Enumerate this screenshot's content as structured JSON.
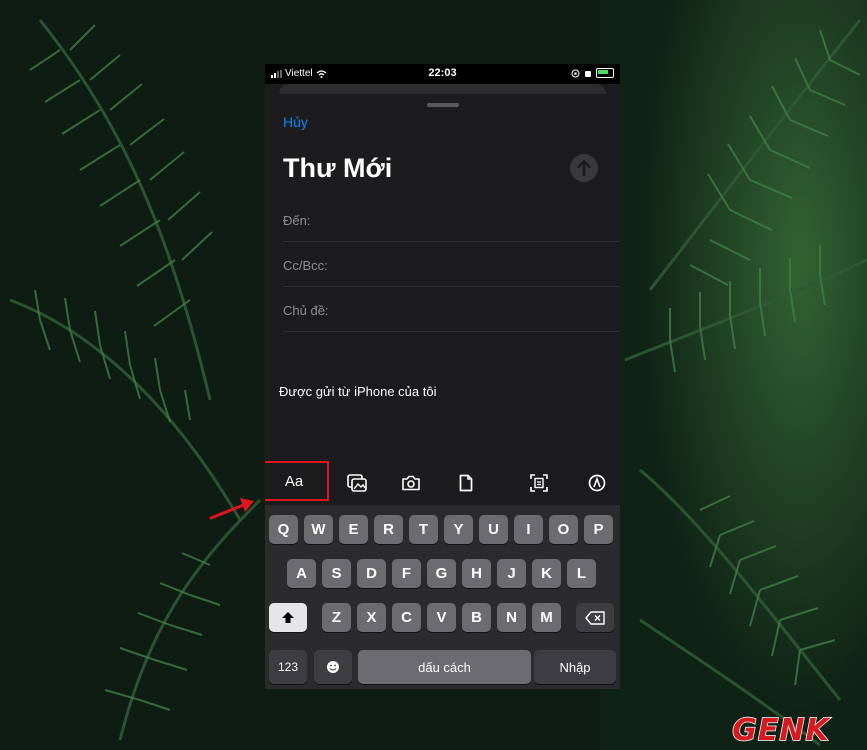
{
  "status_bar": {
    "carrier": "Viettel",
    "time": "22:03"
  },
  "compose": {
    "cancel_label": "Hủy",
    "title": "Thư Mới",
    "fields": [
      {
        "label": "Đến:"
      },
      {
        "label": "Cc/Bcc:"
      },
      {
        "label": "Chủ đề:"
      }
    ],
    "signature": "Được gửi từ iPhone của tôi"
  },
  "toolbar": {
    "format_label": "Aa",
    "icons": [
      "photo-library-icon",
      "camera-icon",
      "document-icon",
      "scan-document-icon",
      "markup-icon"
    ]
  },
  "keyboard": {
    "row1": [
      "Q",
      "W",
      "E",
      "R",
      "T",
      "Y",
      "U",
      "I",
      "O",
      "P"
    ],
    "row2": [
      "A",
      "S",
      "D",
      "F",
      "G",
      "H",
      "J",
      "K",
      "L"
    ],
    "row3": [
      "Z",
      "X",
      "C",
      "V",
      "B",
      "N",
      "M"
    ],
    "numbers_label": "123",
    "space_label": "dấu cách",
    "return_label": "Nhập"
  },
  "watermark": {
    "brand": "GENK"
  },
  "colors": {
    "accent": "#0a84ff",
    "highlight": "#e0161e"
  }
}
